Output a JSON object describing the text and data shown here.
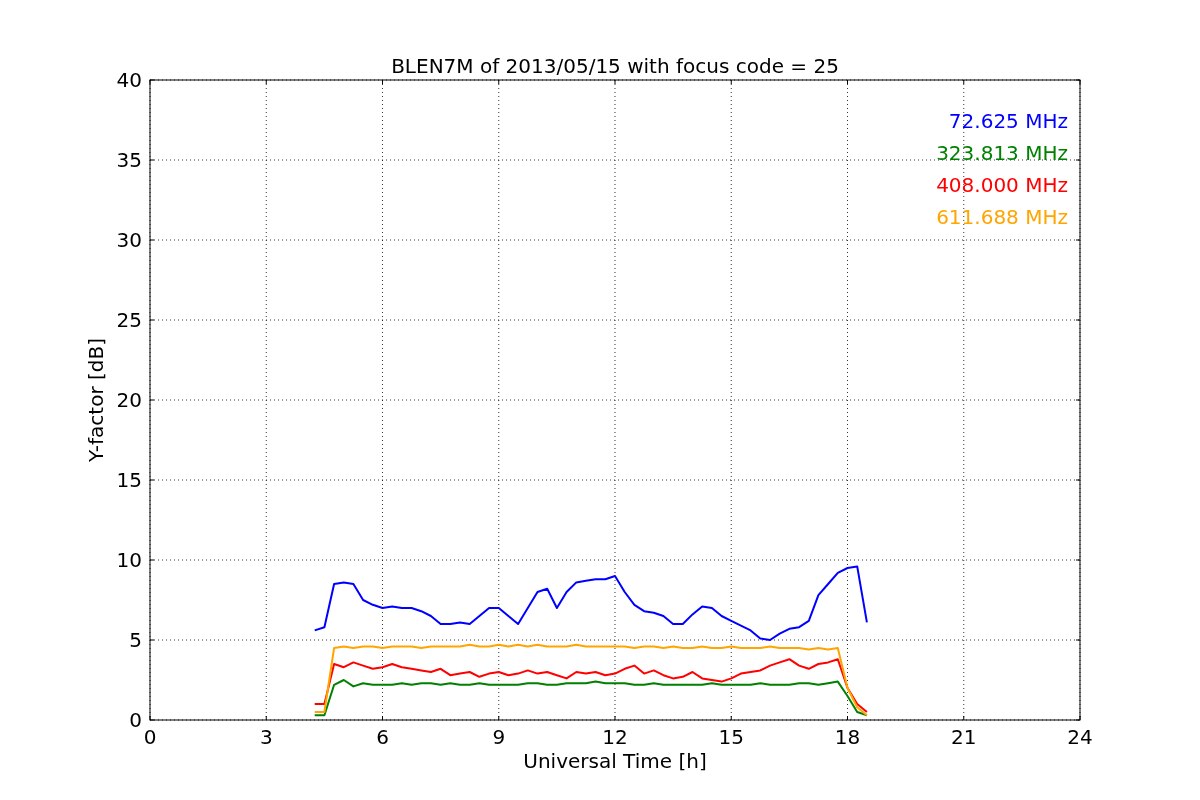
{
  "chart_data": {
    "type": "line",
    "title": "BLEN7M of 2013/05/15 with focus code = 25",
    "xlabel": "Universal Time [h]",
    "ylabel": "Y-factor [dB]",
    "x": [
      4.25,
      4.5,
      4.75,
      5.0,
      5.25,
      5.5,
      5.75,
      6.0,
      6.25,
      6.5,
      6.75,
      7.0,
      7.25,
      7.5,
      7.75,
      8.0,
      8.25,
      8.5,
      8.75,
      9.0,
      9.25,
      9.5,
      9.75,
      10.0,
      10.25,
      10.5,
      10.75,
      11.0,
      11.25,
      11.5,
      11.75,
      12.0,
      12.25,
      12.5,
      12.75,
      13.0,
      13.25,
      13.5,
      13.75,
      14.0,
      14.25,
      14.5,
      14.75,
      15.0,
      15.25,
      15.5,
      15.75,
      16.0,
      16.25,
      16.5,
      16.75,
      17.0,
      17.25,
      17.5,
      17.75,
      18.0,
      18.25,
      18.5
    ],
    "series": [
      {
        "name": "72.625 MHz",
        "color": "#0000ff",
        "values": [
          5.6,
          5.8,
          8.5,
          8.6,
          8.5,
          7.5,
          7.2,
          7.0,
          7.1,
          7.0,
          7.0,
          6.8,
          6.5,
          6.0,
          6.0,
          6.1,
          6.0,
          6.5,
          7.0,
          7.0,
          6.5,
          6.0,
          7.0,
          8.0,
          8.2,
          7.0,
          8.0,
          8.6,
          8.7,
          8.8,
          8.8,
          9.0,
          8.0,
          7.2,
          6.8,
          6.7,
          6.5,
          6.0,
          6.0,
          6.6,
          7.1,
          7.0,
          6.5,
          6.2,
          5.9,
          5.6,
          5.1,
          5.0,
          5.4,
          5.7,
          5.8,
          6.2,
          7.8,
          8.5,
          9.2,
          9.5,
          9.6,
          6.1
        ]
      },
      {
        "name": "323.813 MHz",
        "color": "#008000",
        "values": [
          0.3,
          0.3,
          2.2,
          2.5,
          2.1,
          2.3,
          2.2,
          2.2,
          2.2,
          2.3,
          2.2,
          2.3,
          2.3,
          2.2,
          2.3,
          2.2,
          2.2,
          2.3,
          2.2,
          2.2,
          2.2,
          2.2,
          2.3,
          2.3,
          2.2,
          2.2,
          2.3,
          2.3,
          2.3,
          2.4,
          2.3,
          2.3,
          2.3,
          2.2,
          2.2,
          2.3,
          2.2,
          2.2,
          2.2,
          2.2,
          2.2,
          2.3,
          2.2,
          2.2,
          2.2,
          2.2,
          2.3,
          2.2,
          2.2,
          2.2,
          2.3,
          2.3,
          2.2,
          2.3,
          2.4,
          1.5,
          0.5,
          0.3
        ]
      },
      {
        "name": "408.000 MHz",
        "color": "#ff0000",
        "values": [
          1.0,
          1.0,
          3.5,
          3.3,
          3.6,
          3.4,
          3.2,
          3.3,
          3.5,
          3.3,
          3.2,
          3.1,
          3.0,
          3.2,
          2.8,
          2.9,
          3.0,
          2.7,
          2.9,
          3.0,
          2.8,
          2.9,
          3.1,
          2.9,
          3.0,
          2.8,
          2.6,
          3.0,
          2.9,
          3.0,
          2.8,
          2.9,
          3.2,
          3.4,
          2.9,
          3.1,
          2.8,
          2.6,
          2.7,
          3.0,
          2.6,
          2.5,
          2.4,
          2.6,
          2.9,
          3.0,
          3.1,
          3.4,
          3.6,
          3.8,
          3.4,
          3.2,
          3.5,
          3.6,
          3.8,
          2.0,
          1.0,
          0.5
        ]
      },
      {
        "name": "611.688 MHz",
        "color": "#ffa500",
        "values": [
          0.5,
          0.5,
          4.5,
          4.6,
          4.5,
          4.6,
          4.6,
          4.5,
          4.6,
          4.6,
          4.6,
          4.5,
          4.6,
          4.6,
          4.6,
          4.6,
          4.7,
          4.6,
          4.6,
          4.7,
          4.6,
          4.7,
          4.6,
          4.7,
          4.6,
          4.6,
          4.6,
          4.7,
          4.6,
          4.6,
          4.6,
          4.6,
          4.6,
          4.5,
          4.6,
          4.6,
          4.5,
          4.6,
          4.5,
          4.5,
          4.6,
          4.5,
          4.5,
          4.6,
          4.5,
          4.5,
          4.5,
          4.6,
          4.5,
          4.5,
          4.5,
          4.4,
          4.5,
          4.4,
          4.5,
          2.0,
          0.8,
          0.3
        ]
      }
    ],
    "xlim": [
      0,
      24
    ],
    "ylim": [
      0,
      40
    ],
    "grid": true,
    "xticks": [
      0,
      3,
      6,
      9,
      12,
      15,
      18,
      21,
      24
    ],
    "yticks": [
      0,
      5,
      10,
      15,
      20,
      25,
      30,
      35,
      40
    ]
  }
}
